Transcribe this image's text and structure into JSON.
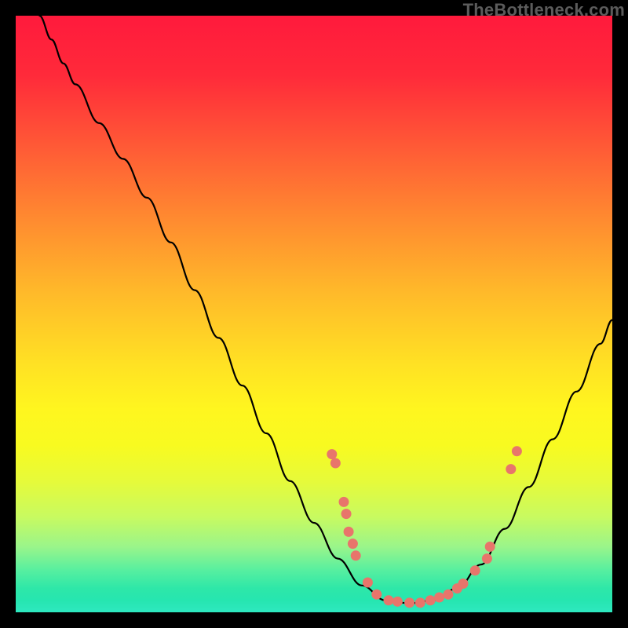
{
  "watermark": "TheBottleneck.com",
  "chart_data": {
    "type": "line",
    "title": "",
    "xlabel": "",
    "ylabel": "",
    "xlim": [
      0,
      100
    ],
    "ylim": [
      0,
      100
    ],
    "grid": false,
    "curve": [
      {
        "x": 4.0,
        "y": 100.0
      },
      {
        "x": 6.0,
        "y": 96.0
      },
      {
        "x": 8.0,
        "y": 92.0
      },
      {
        "x": 10.0,
        "y": 88.5
      },
      {
        "x": 14.0,
        "y": 82.0
      },
      {
        "x": 18.0,
        "y": 76.0
      },
      {
        "x": 22.0,
        "y": 69.5
      },
      {
        "x": 26.0,
        "y": 62.0
      },
      {
        "x": 30.0,
        "y": 54.0
      },
      {
        "x": 34.0,
        "y": 46.0
      },
      {
        "x": 38.0,
        "y": 38.0
      },
      {
        "x": 42.0,
        "y": 30.0
      },
      {
        "x": 46.0,
        "y": 22.0
      },
      {
        "x": 50.0,
        "y": 15.0
      },
      {
        "x": 54.0,
        "y": 9.0
      },
      {
        "x": 58.0,
        "y": 4.5
      },
      {
        "x": 62.0,
        "y": 2.0
      },
      {
        "x": 66.0,
        "y": 1.5
      },
      {
        "x": 70.0,
        "y": 2.0
      },
      {
        "x": 74.0,
        "y": 4.0
      },
      {
        "x": 78.0,
        "y": 8.0
      },
      {
        "x": 82.0,
        "y": 14.0
      },
      {
        "x": 86.0,
        "y": 21.0
      },
      {
        "x": 90.0,
        "y": 29.0
      },
      {
        "x": 94.0,
        "y": 37.0
      },
      {
        "x": 98.0,
        "y": 45.0
      },
      {
        "x": 100.0,
        "y": 49.0
      }
    ],
    "points": [
      {
        "x": 53.0,
        "y": 26.5
      },
      {
        "x": 53.6,
        "y": 25.0
      },
      {
        "x": 55.0,
        "y": 18.5
      },
      {
        "x": 55.4,
        "y": 16.5
      },
      {
        "x": 55.8,
        "y": 13.5
      },
      {
        "x": 56.5,
        "y": 11.5
      },
      {
        "x": 57.0,
        "y": 9.5
      },
      {
        "x": 59.0,
        "y": 5.0
      },
      {
        "x": 60.5,
        "y": 3.0
      },
      {
        "x": 62.5,
        "y": 2.0
      },
      {
        "x": 64.0,
        "y": 1.8
      },
      {
        "x": 66.0,
        "y": 1.6
      },
      {
        "x": 67.8,
        "y": 1.6
      },
      {
        "x": 69.5,
        "y": 2.0
      },
      {
        "x": 71.0,
        "y": 2.5
      },
      {
        "x": 72.5,
        "y": 3.0
      },
      {
        "x": 74.0,
        "y": 4.0
      },
      {
        "x": 75.0,
        "y": 4.8
      },
      {
        "x": 77.0,
        "y": 7.0
      },
      {
        "x": 79.0,
        "y": 9.0
      },
      {
        "x": 79.5,
        "y": 11.0
      },
      {
        "x": 83.0,
        "y": 24.0
      },
      {
        "x": 84.0,
        "y": 27.0
      }
    ],
    "marker_color": "#e8756b",
    "line_color": "#000000"
  }
}
